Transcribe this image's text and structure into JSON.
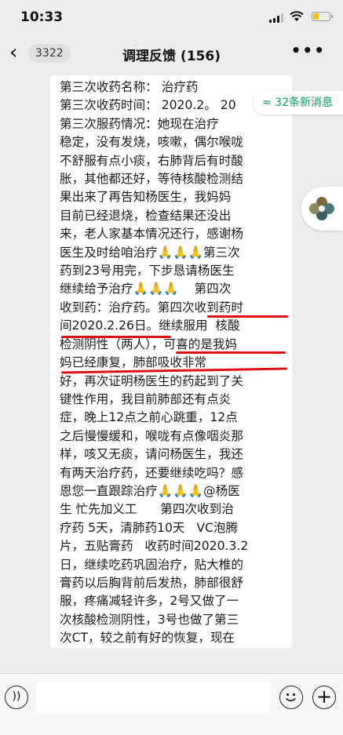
{
  "status": {
    "time": "10:33"
  },
  "nav": {
    "back_icon": "chevron-left-icon",
    "unread_badge": "3322",
    "title": "调理反馈 (156)",
    "more_icon": "more-icon"
  },
  "message": {
    "text": "第三次收药名称： 治疗药\n第三次收药时间： 2020.2。 20\n第三次服药情况：她现在治疗\n稳定，没有发烧，咳嗽，偶尔喉咙\n不舒服有点小痰，右肺背后有时酸\n胀，其他都还好，等待核酸检测结\n果出来了再告知杨医生，我妈妈\n目前已经退烧，检查结果还没出\n来，老人家基本情况还行，感谢杨\n医生及时给咱治疗🙏🙏🙏第三次\n药到23号用完，下步恳请杨医生\n继续给予治疗🙏🙏🙏    第四次\n收到药：治疗药。第四次收到药时\n间2020.2.26日。继续服用  核酸\n检测阴性（两人），可喜的是我妈\n妈已经康复，肺部吸收非常\n好，再次证明杨医生的药起到了关\n键性作用，我目前肺部还有点炎\n症，晚上12点之前心跳重，12点\n之后慢慢缓和，喉咙有点像咽炎那\n样，咳又无痰，请问杨医生，我还\n有两天治疗药，还要继续吃吗？感\n恩您一直跟踪治疗🙏🙏🙏@杨医\n生 忙先加义工      第四次收到治\n疗药 5天，清肺药10天   VC泡腾\n片，五贴膏药   收药时间2020.3.2\n日，继续吃药巩固治疗，贴大椎的\n膏药以后胸背前后发热，肺部很舒\n服，疼痛减轻许多，2号又做了一\n次核酸检测阴性，3号也做了第三\n次CT，较之前有好的恢复，现在\n专吃杨医生的中药，我坚信会完全\n恢复吸收的，感恩杨医生🙏🙏🙏"
  },
  "new_messages": {
    "label": "≈ 32条新消息"
  },
  "bottom": {
    "voice_icon": "voice-icon",
    "emoji_icon": "emoji-icon",
    "plus_icon": "plus-icon"
  },
  "colors": {
    "background": "#ededed",
    "bubble": "#ffffff",
    "accent_green": "#07a15a",
    "underline_red": "#dd1111"
  }
}
